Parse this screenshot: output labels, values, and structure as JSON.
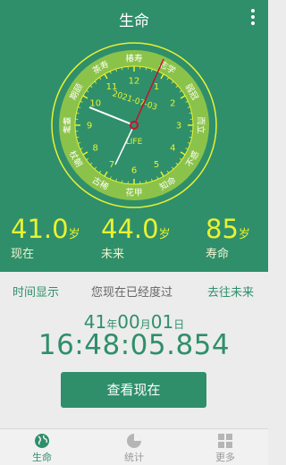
{
  "app": {
    "title": "生命"
  },
  "clock": {
    "ring_labels": [
      "不惑",
      "知命",
      "花甲",
      "古稀",
      "耄耋",
      "期颐",
      "茶寿",
      "椿寿",
      "而立",
      "弱冠",
      "志学",
      "桃李",
      "舞勺",
      "耄耋"
    ],
    "top_labels": [
      "茶寿",
      "椿寿",
      "志学"
    ],
    "numbers": [
      "12",
      "1",
      "2",
      "3",
      "4",
      "5",
      "6",
      "7",
      "8",
      "9",
      "10",
      "11"
    ],
    "date_text": "2021-07-03",
    "center_text": "LIFE"
  },
  "stats": {
    "now": {
      "value": "41.0",
      "unit": "岁",
      "label": "现在"
    },
    "future": {
      "value": "44.0",
      "unit": "岁",
      "label": "未来"
    },
    "life": {
      "value": "85",
      "unit": "岁",
      "label": "寿命"
    }
  },
  "tabs": {
    "left": "时间显示",
    "middle": "您现在已经度过",
    "right": "去往未来"
  },
  "elapsed": {
    "years": "41",
    "years_unit": "年",
    "months": "00",
    "months_unit": "月",
    "days": "01",
    "days_unit": "日",
    "time": "16:48:05.854"
  },
  "button": {
    "label": "查看现在"
  },
  "nav": {
    "items": [
      {
        "label": "生命",
        "icon": "globe-icon"
      },
      {
        "label": "统计",
        "icon": "pie-chart-icon"
      },
      {
        "label": "更多",
        "icon": "grid-icon"
      }
    ]
  },
  "colors": {
    "primary": "#2f8f6b",
    "accent": "#e9f230",
    "ring": "#8bc34a",
    "hand": "#c8102e"
  }
}
